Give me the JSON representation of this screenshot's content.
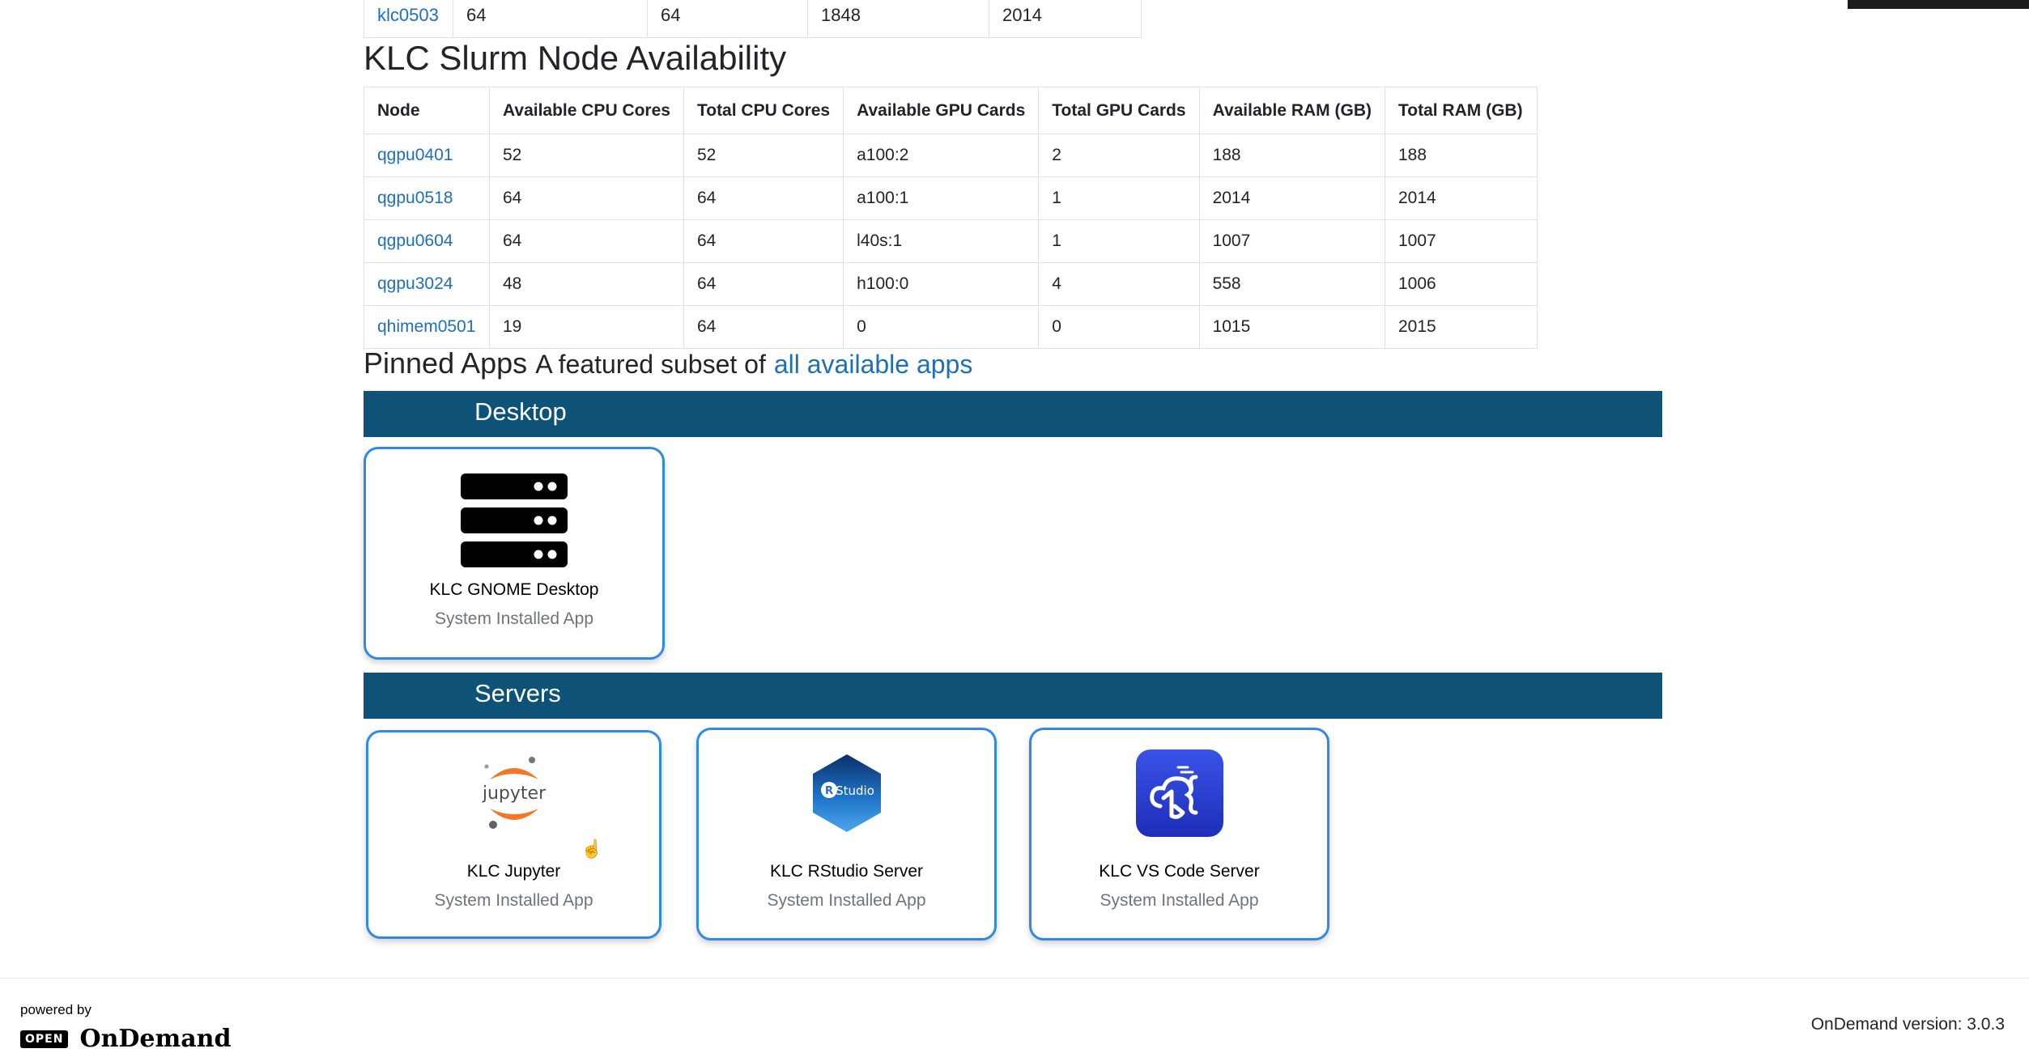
{
  "top_row": [
    "klc0503",
    "64",
    "64",
    "1848",
    "2014"
  ],
  "slurm": {
    "title": "KLC Slurm Node Availability",
    "headers": [
      "Node",
      "Available CPU Cores",
      "Total CPU Cores",
      "Available GPU Cards",
      "Total GPU Cards",
      "Available RAM (GB)",
      "Total RAM (GB)"
    ],
    "rows": [
      [
        "qgpu0401",
        "52",
        "52",
        "a100:2",
        "2",
        "188",
        "188"
      ],
      [
        "qgpu0518",
        "64",
        "64",
        "a100:1",
        "1",
        "2014",
        "2014"
      ],
      [
        "qgpu0604",
        "64",
        "64",
        "l40s:1",
        "1",
        "1007",
        "1007"
      ],
      [
        "qgpu3024",
        "48",
        "64",
        "h100:0",
        "4",
        "558",
        "1006"
      ],
      [
        "qhimem0501",
        "19",
        "64",
        "0",
        "0",
        "1015",
        "2015"
      ]
    ]
  },
  "pinned": {
    "title": "Pinned Apps",
    "subtitle": "A featured subset of",
    "link": "all available apps"
  },
  "categories": {
    "desktop": "Desktop",
    "servers": "Servers"
  },
  "apps": {
    "gnome": {
      "name": "KLC GNOME Desktop",
      "type": "System Installed App",
      "icon": "server-icon"
    },
    "jupyter": {
      "name": "KLC Jupyter",
      "type": "System Installed App",
      "icon": "jupyter-icon",
      "logo_text": "jupyter"
    },
    "rstudio": {
      "name": "KLC RStudio Server",
      "type": "System Installed App",
      "icon": "rstudio-icon",
      "logo_text": "Studio",
      "logo_letter": "R"
    },
    "vscode": {
      "name": "KLC VS Code Server",
      "type": "System Installed App",
      "icon": "vscode-icon"
    }
  },
  "footer": {
    "powered_by": "powered by",
    "logo_open": "OPEN",
    "logo_ondemand": "OnDemand",
    "version": "OnDemand version: 3.0.3"
  },
  "colors": {
    "category_bar": "#0e5377",
    "link": "#1f6fb8",
    "card_border": "#2e8ae6"
  }
}
